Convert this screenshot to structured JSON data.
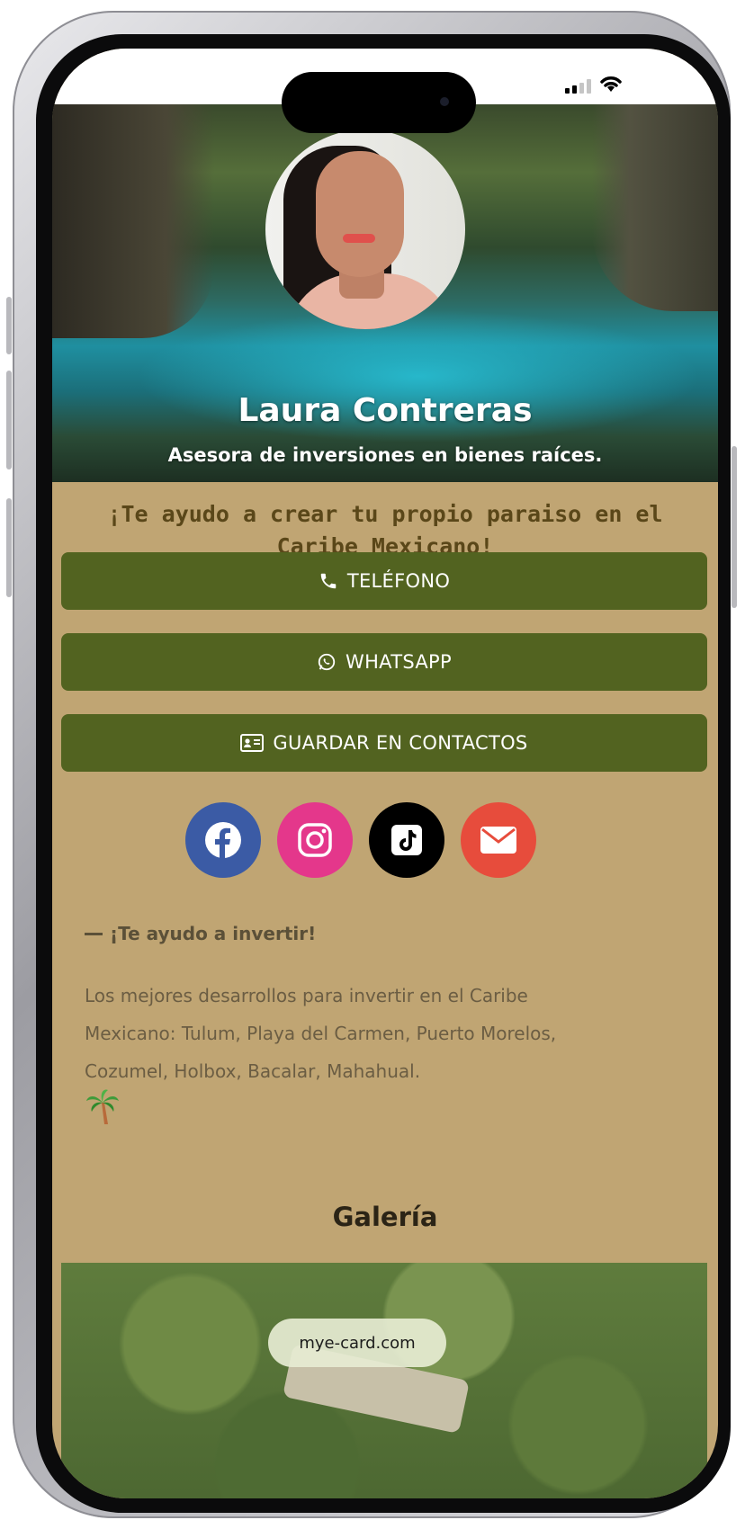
{
  "status_bar": {
    "signal_icon": "cellular-signal-icon",
    "wifi_icon": "wifi-icon"
  },
  "profile": {
    "name": "Laura Contreras",
    "title": "Asesora de inversiones en bienes raíces.",
    "tagline": "¡Te ayudo a crear tu propio paraiso en el Caribe Mexicano!"
  },
  "actions": {
    "phone_label": "TELÉFONO",
    "whatsapp_label": "WHATSAPP",
    "save_contact_label": "GUARDAR EN CONTACTOS"
  },
  "socials": [
    {
      "icon": "facebook-icon",
      "color": "#3b5ba5"
    },
    {
      "icon": "instagram-icon",
      "color": "#e4378b"
    },
    {
      "icon": "tiktok-icon",
      "color": "#000000"
    },
    {
      "icon": "email-icon",
      "color": "#e74c3c"
    }
  ],
  "about": {
    "heading": "¡Te ayudo a invertir!",
    "body": "Los mejores desarrollos para invertir en el Caribe Mexicano: Tulum, Playa del Carmen, Puerto Morelos, Cozumel, Holbox, Bacalar, Mahahual."
  },
  "gallery": {
    "title": "Galería"
  },
  "browser": {
    "url": "mye-card.com"
  },
  "colors": {
    "background": "#c0a573",
    "button": "#526320",
    "tagline": "#5a4719"
  }
}
